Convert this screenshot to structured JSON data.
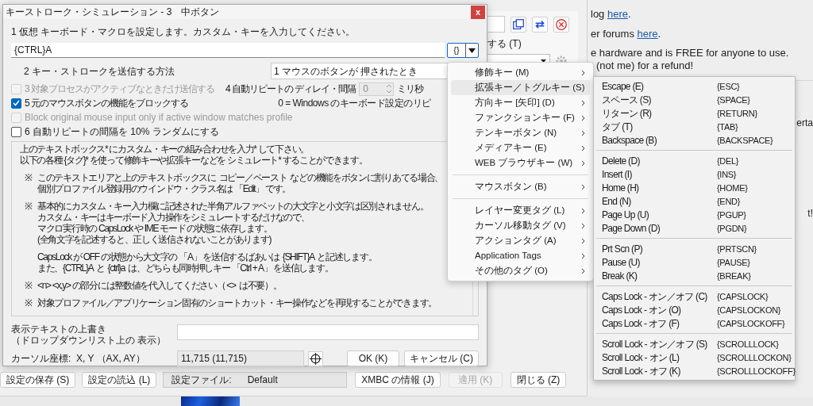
{
  "web_page": {
    "lines": [
      {
        "text": "log ",
        "link": "here",
        "after": "."
      },
      {
        "text": "er forums ",
        "link": "here",
        "after": "."
      },
      {
        "text": "e hardware and is FREE for anyone to use."
      },
      {
        "text": "(not me) for a refund!"
      }
    ],
    "fragments": [
      "erta",
      "t!"
    ]
  },
  "background_window": {
    "option_label": "する (T)",
    "buttons_left": [
      {
        "label": "設定の保存 (S)",
        "disabled": false
      },
      {
        "label": "設定の読込 (L)",
        "disabled": false
      }
    ],
    "settings_file": {
      "label": "設定ファイル:",
      "value": "Default"
    },
    "buttons_right": [
      {
        "label": "XMBC の情報 (J)",
        "disabled": false
      },
      {
        "label": "適用 (K)",
        "disabled": true
      },
      {
        "label": "閉じる (Z)",
        "disabled": false
      }
    ]
  },
  "dialog": {
    "title": "キーストローク・シミュレーション - 3　中ボタン",
    "close_label": "x",
    "macro_label": "1 仮想 キーボード・マクロを設定します。カスタム・キーを入力してください。",
    "macro_value": "{CTRL}A",
    "tag_button": "{}",
    "send_method_label": "2 キー・ストロークを送信する方法",
    "send_method_value": "1 マウスのボタンが 押されたとき",
    "checkboxes": [
      {
        "label": "3 対象プロセスがアクティブなときだけ送信する",
        "checked": false,
        "disabled": true
      },
      {
        "label": "5 元のマウスボタンの機能をブロックする",
        "checked": true,
        "disabled": false
      },
      {
        "label": "Block original mouse input only if active window matches profile",
        "checked": false,
        "disabled": true
      },
      {
        "label": "6 自動リピートの間隔を 10% ランダムにする",
        "checked": false,
        "disabled": false
      }
    ],
    "repeat_label": "4 自動リピートの ディレイ・間隔",
    "repeat_value": "0",
    "repeat_unit": "ミリ秒",
    "repeat_note": "0 = Windows のキーボード設定のリピ",
    "help": {
      "intro": [
        "上のテキストボックス* にカスタム・キーの組み合わせを入力* して下さい。",
        "以下の各種 {タグ}* を使って修飾キーや拡張キーなどを シミュレート* することができます。"
      ],
      "notes": [
        {
          "mark": "※",
          "lines": [
            "このテキストエリアと上のテキストボックスに  コピー／ペースト  などの機能をボタンに割りあてる場合、",
            "個別プロファイル登録用のウインドウ・クラス名は 「Edit」 です。"
          ]
        },
        {
          "mark": "※",
          "lines": [
            "基本的にカスタム・キー入力欄に記述された半角アルファベットの大文字と小文字は区別されません。",
            "カスタム・キーはキーボード入力操作をシミュレートするだけなので、",
            "マクロ実行時の CapsLock や IME モード の状態に依存します。",
            "(全角文字を記述すると、正しく送信されないことがあります)"
          ]
        },
        {
          "lines": [
            "CapsLock が OFF の状態から大文字の 「A」 を送信するばあいは  {SHIFT}A  と記述します。",
            "また、{CTRL}A  と  {ctrl}a  は、どちらも同時押しキー 「Ctrl + A」 を送信します。"
          ]
        },
        {
          "mark": "※",
          "lines": [
            "<n> <x,y> の部分には整数値を代入してください（ <>  は不要）。"
          ]
        },
        {
          "mark": "※",
          "lines": [
            "対象プロファイル／アプリケーション固有のショートカット・キー操作などを再現することができます。"
          ]
        }
      ]
    },
    "override_label": [
      "表示テキストの上書き",
      "（ドロップダウンリスト上の 表示）"
    ],
    "cursor_label": "カーソル座標:  X, Y （AX, AY）",
    "cursor_value": "11,715 (11,715)",
    "buttons": [
      "OK (K)",
      "キャンセル (C)"
    ]
  },
  "context_menu": {
    "groups": [
      [
        {
          "label": "修飾キー (M)",
          "selected": false
        },
        {
          "label": "拡張キー／トグルキー (S)",
          "selected": true
        },
        {
          "label": "方向キー [矢印] (D)",
          "selected": false
        },
        {
          "label": "ファンクションキー (F)",
          "selected": false
        },
        {
          "label": "テンキーボタン (N)",
          "selected": false
        },
        {
          "label": "メディアキー (E)",
          "selected": false
        },
        {
          "label": "WEB ブラウザキー (W)",
          "selected": false
        }
      ],
      [
        {
          "label": "マウスボタン (B)",
          "selected": false
        }
      ],
      [
        {
          "label": "レイヤー変更タグ (L)",
          "selected": false
        },
        {
          "label": "カーソル移動タグ (V)",
          "selected": false
        },
        {
          "label": "アクションタグ (A)",
          "selected": false
        },
        {
          "label": "Application Tags",
          "selected": false
        },
        {
          "label": "その他のタグ (O)",
          "selected": false
        }
      ]
    ]
  },
  "submenu": {
    "groups": [
      [
        {
          "label": "Escape (E)",
          "tag": "{ESC}"
        },
        {
          "label": "スペース (S)",
          "tag": "{SPACE}"
        },
        {
          "label": "リターン (R)",
          "tag": "{RETURN}"
        },
        {
          "label": "タブ (T)",
          "tag": "{TAB}"
        },
        {
          "label": "Backspace (B)",
          "tag": "{BACKSPACE}"
        }
      ],
      [
        {
          "label": "Delete (D)",
          "tag": "{DEL}"
        },
        {
          "label": "Insert (I)",
          "tag": "{INS}"
        },
        {
          "label": "Home (H)",
          "tag": "{HOME}"
        },
        {
          "label": "End (N)",
          "tag": "{END}"
        },
        {
          "label": "Page Up (U)",
          "tag": "{PGUP}"
        },
        {
          "label": "Page Down (D)",
          "tag": "{PGDN}"
        }
      ],
      [
        {
          "label": "Prt Scn (P)",
          "tag": "{PRTSCN}"
        },
        {
          "label": "Pause (U)",
          "tag": "{PAUSE}"
        },
        {
          "label": "Break (K)",
          "tag": "{BREAK}"
        }
      ],
      [
        {
          "label": "Caps Lock - オン／オフ (C)",
          "tag": "{CAPSLOCK}"
        },
        {
          "label": "Caps Lock - オン (O)",
          "tag": "{CAPSLOCKON}"
        },
        {
          "label": "Caps Lock - オフ (F)",
          "tag": "{CAPSLOCKOFF}"
        }
      ],
      [
        {
          "label": "Scroll Lock - オン／オフ (S)",
          "tag": "{SCROLLLOCK}"
        },
        {
          "label": "Scroll Lock - オン (L)",
          "tag": "{SCROLLLOCKON}"
        },
        {
          "label": "Scroll Lock - オフ (K)",
          "tag": "{SCROLLLOCKOFF}"
        }
      ]
    ]
  }
}
